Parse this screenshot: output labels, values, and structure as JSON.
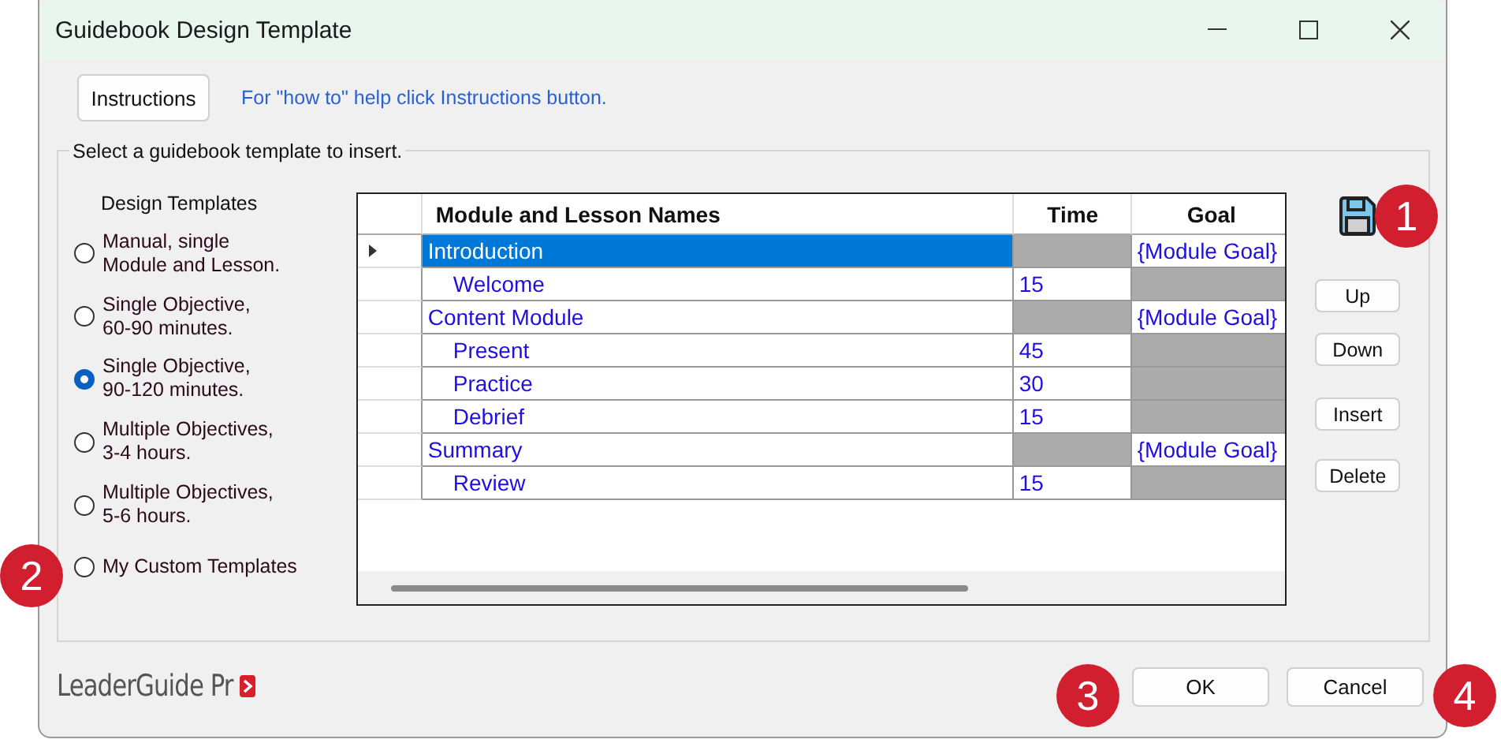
{
  "window": {
    "title": "Guidebook Design Template"
  },
  "instructions_button": "Instructions",
  "help_text": "For \"how to\" help click Instructions button.",
  "group": {
    "legend": "Select a guidebook template to insert."
  },
  "templates": {
    "heading": "Design Templates",
    "options": [
      {
        "label": "Manual, single\nModule and Lesson.",
        "selected": false
      },
      {
        "label": "Single Objective,\n60-90 minutes.",
        "selected": false
      },
      {
        "label": "Single Objective,\n90-120 minutes.",
        "selected": true
      },
      {
        "label": "Multiple Objectives,\n3-4 hours.",
        "selected": false
      },
      {
        "label": "Multiple Objectives,\n5-6 hours.",
        "selected": false
      },
      {
        "label": "My Custom Templates",
        "selected": false
      }
    ]
  },
  "grid": {
    "columns": [
      "Module and Lesson Names",
      "Time",
      "Goal"
    ],
    "rows": [
      {
        "kind": "module",
        "name": "Introduction",
        "goal": "{Module Goal}",
        "selected": true
      },
      {
        "kind": "lesson",
        "name": "Welcome",
        "time": "15",
        "selected": false
      },
      {
        "kind": "module",
        "name": "Content Module",
        "goal": "{Module Goal}",
        "selected": false
      },
      {
        "kind": "lesson",
        "name": "Present",
        "time": "45",
        "selected": false
      },
      {
        "kind": "lesson",
        "name": "Practice",
        "time": "30",
        "selected": false
      },
      {
        "kind": "lesson",
        "name": "Debrief",
        "time": "15",
        "selected": false
      },
      {
        "kind": "module",
        "name": "Summary",
        "goal": "{Module Goal}",
        "selected": false
      },
      {
        "kind": "lesson",
        "name": "Review",
        "time": "15",
        "selected": false
      }
    ]
  },
  "side_buttons": [
    "Up",
    "Down",
    "Insert",
    "Delete"
  ],
  "footer": {
    "logo": "LeaderGuide Pr",
    "buttons": [
      "OK",
      "Cancel"
    ]
  },
  "callouts": [
    "1",
    "2",
    "3",
    "4"
  ]
}
